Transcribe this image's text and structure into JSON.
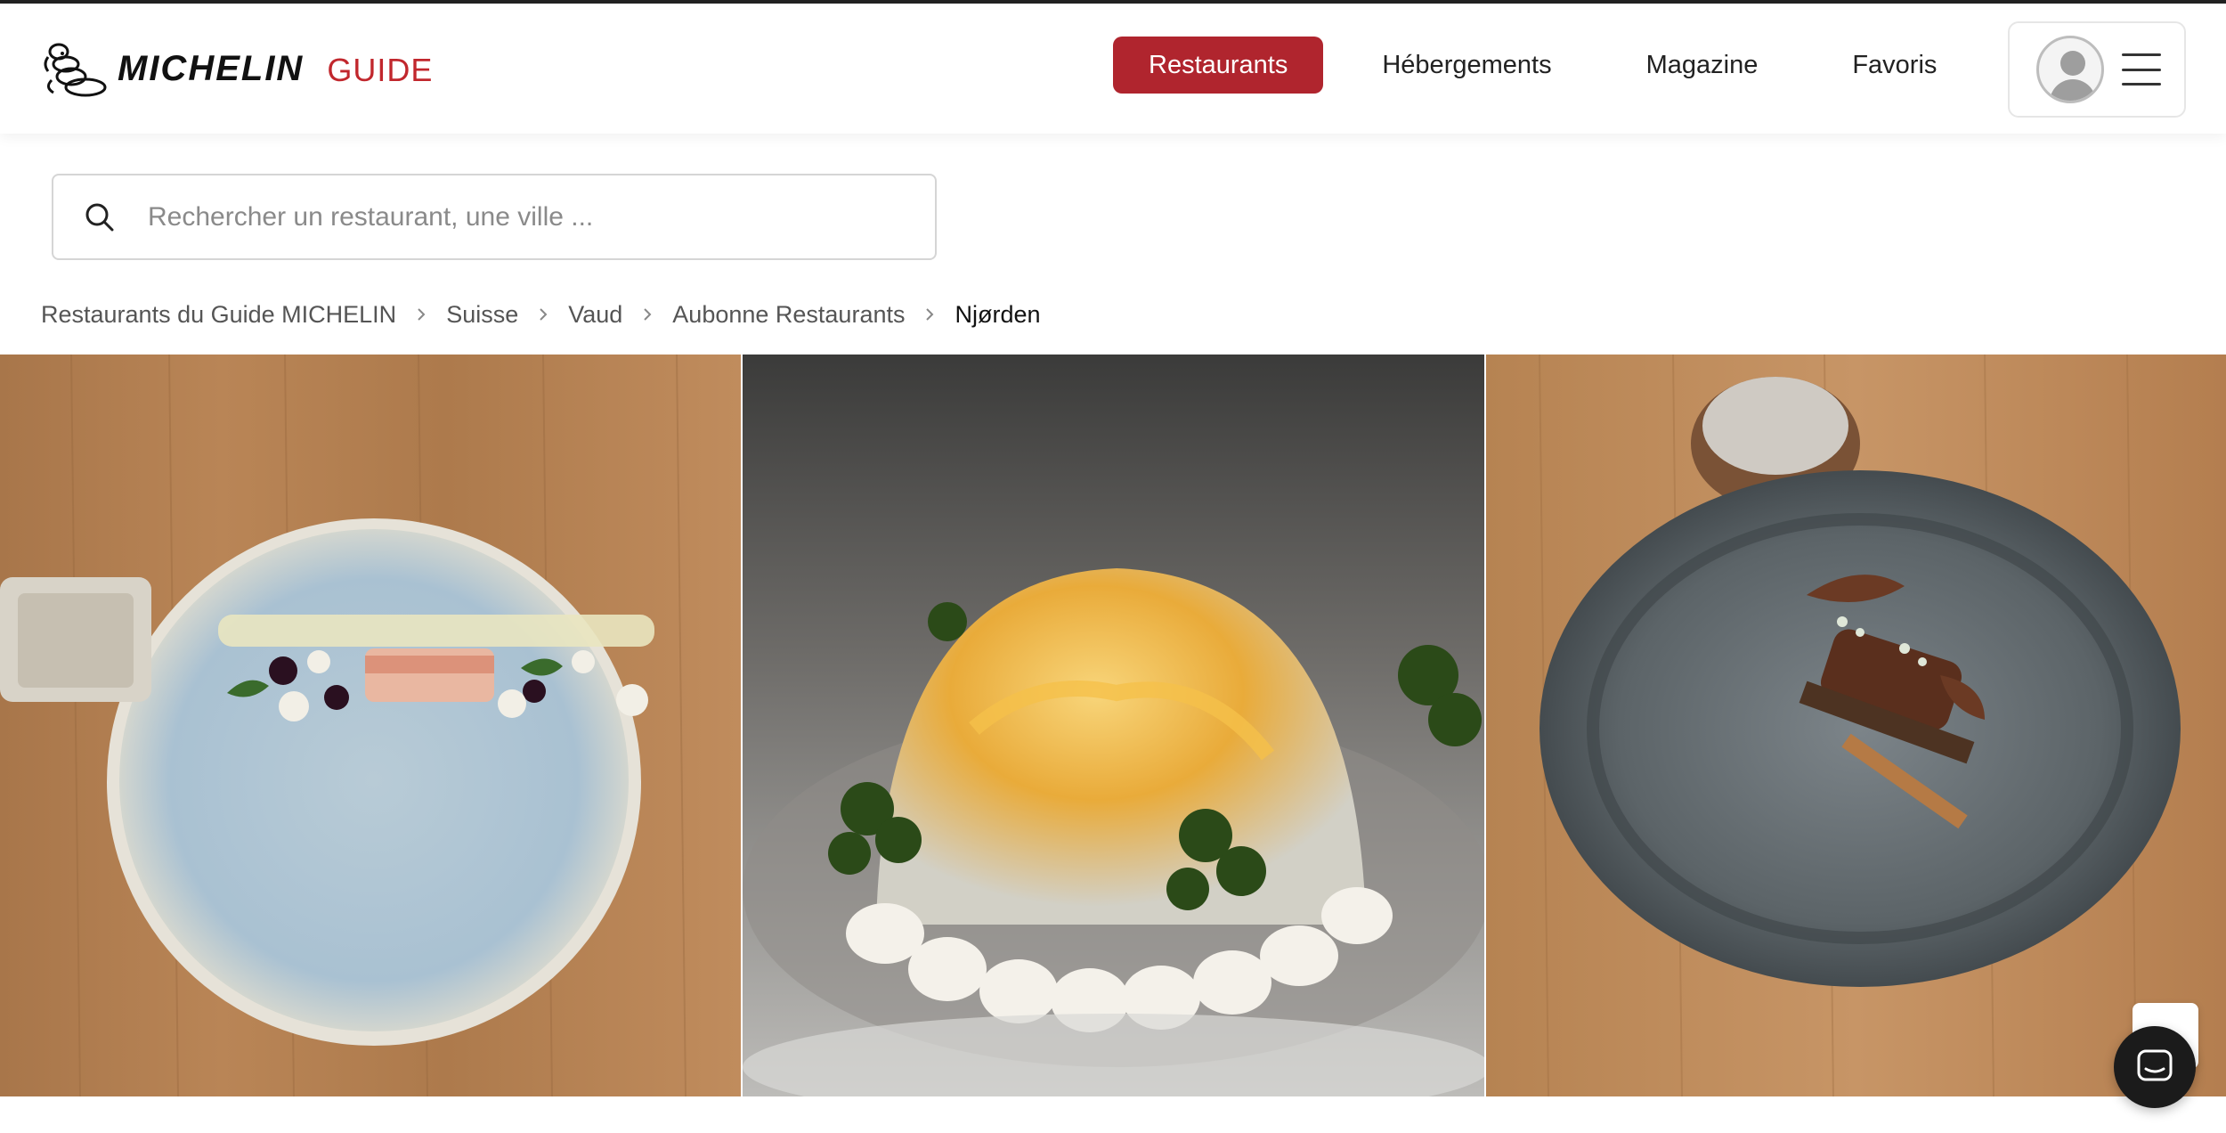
{
  "brand": {
    "wordmark": "MICHELIN",
    "guide_label": "GUIDE",
    "accent_color": "#b0252e"
  },
  "nav": {
    "items": [
      {
        "label": "Restaurants",
        "active": true
      },
      {
        "label": "Hébergements",
        "active": false
      },
      {
        "label": "Magazine",
        "active": false
      },
      {
        "label": "Favoris",
        "active": false
      }
    ]
  },
  "user_menu": {
    "avatar_icon": "user-avatar-icon",
    "menu_icon": "hamburger-menu-icon"
  },
  "search": {
    "placeholder": "Rechercher un restaurant, une ville ...",
    "value": "",
    "icon": "search-icon"
  },
  "breadcrumb": {
    "items": [
      "Restaurants du Guide MICHELIN",
      "Suisse",
      "Vaud",
      "Aubonne Restaurants",
      "Njørden"
    ]
  },
  "gallery": {
    "photos": [
      {
        "name": "plated-fish-dish-photo"
      },
      {
        "name": "citrus-dome-dessert-photo"
      },
      {
        "name": "chocolate-dessert-photo"
      }
    ]
  },
  "widgets": {
    "chat_icon": "chat-bubble-icon",
    "feedback_icon": "feedback-icon"
  }
}
